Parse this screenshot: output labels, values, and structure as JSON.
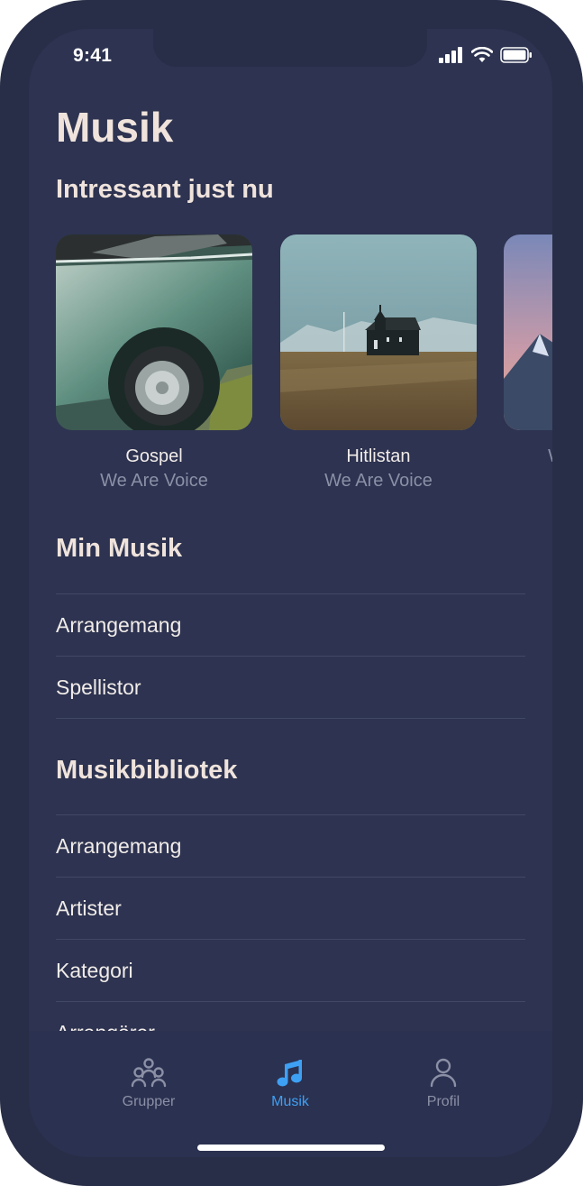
{
  "status_bar": {
    "time": "9:41"
  },
  "page": {
    "title": "Musik"
  },
  "featured": {
    "heading": "Intressant just nu",
    "cards": [
      {
        "title": "Gospel",
        "subtitle": "We Are Voice"
      },
      {
        "title": "Hitlistan",
        "subtitle": "We Are Voice"
      },
      {
        "title": "",
        "subtitle": "We Are Voice"
      }
    ]
  },
  "my_music": {
    "heading": "Min Musik",
    "items": [
      "Arrangemang",
      "Spellistor"
    ]
  },
  "library": {
    "heading": "Musikbibliotek",
    "items": [
      "Arrangemang",
      "Artister",
      "Kategori",
      "Arrangörer"
    ]
  },
  "tabbar": {
    "tabs": [
      {
        "label": "Grupper",
        "icon": "groups-icon",
        "active": false
      },
      {
        "label": "Musik",
        "icon": "music-note-icon",
        "active": true
      },
      {
        "label": "Profil",
        "icon": "profile-icon",
        "active": false
      }
    ],
    "active_color": "#3ea0f3",
    "inactive_color": "#8b90a6"
  }
}
